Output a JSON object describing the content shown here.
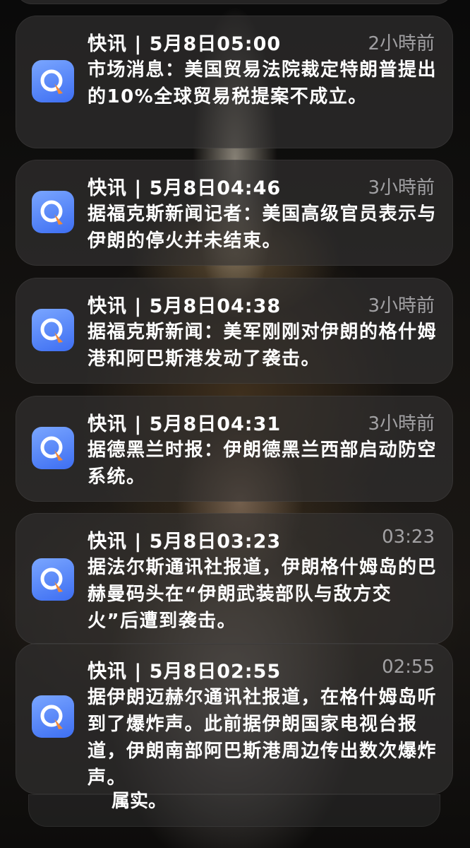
{
  "notifications": [
    {
      "title": "快讯 | 5月8日05:00",
      "time": "2小時前",
      "message": "市场消息：美国贸易法院裁定特朗普提出的10%全球贸易税提案不成立。"
    },
    {
      "title": "快讯 | 5月8日04:46",
      "time": "3小時前",
      "message": "据福克斯新闻记者：美国高级官员表示与伊朗的停火并未结束。"
    },
    {
      "title": "快讯 | 5月8日04:38",
      "time": "3小時前",
      "message": "据福克斯新闻：美军刚刚对伊朗的格什姆港和阿巴斯港发动了袭击。"
    },
    {
      "title": "快讯 | 5月8日04:31",
      "time": "3小時前",
      "message": "据德黑兰时报：伊朗德黑兰西部启动防空系统。"
    },
    {
      "title": "快讯 | 5月8日03:23",
      "time": "03:23",
      "message": "据法尔斯通讯社报道，伊朗格什姆岛的巴赫曼码头在“伊朗武装部队与敌方交火”后遭到袭击。"
    },
    {
      "title": "快讯 | 5月8日02:55",
      "time": "02:55",
      "message": "据伊朗迈赫尔通讯社报道，在格什姆岛听到了爆炸声。此前据伊朗国家电视台报道，伊朗南部阿巴斯港周边传出数次爆炸声。"
    }
  ],
  "bottom_partial_text": "属实。",
  "icon": "news-app-icon",
  "colors": {
    "icon_light": "#7aa6ff",
    "icon_dark": "#3d6ef2",
    "icon_accent": "#f08a3c"
  }
}
